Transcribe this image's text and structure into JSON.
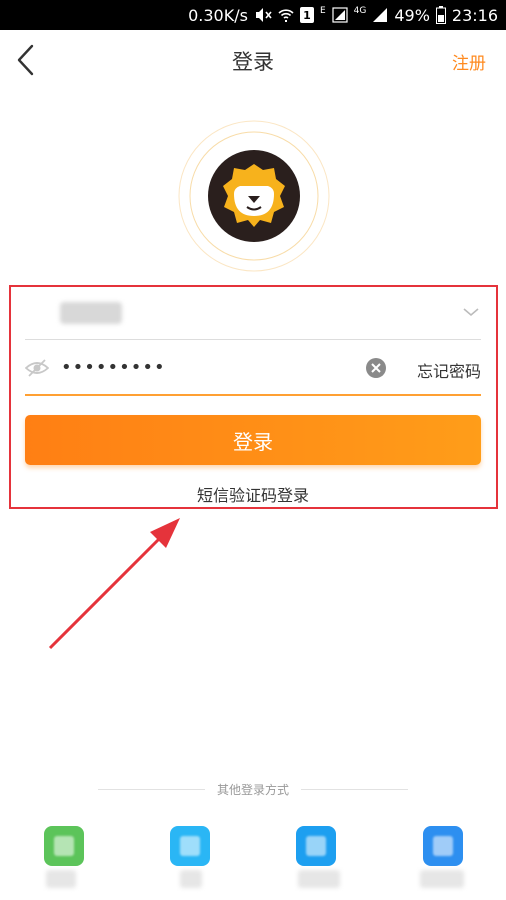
{
  "status_bar": {
    "speed": "0.30K/s",
    "sim": "1",
    "network_e": "E",
    "network_4g": "4G",
    "battery": "49%",
    "time": "23:16"
  },
  "header": {
    "title": "登录",
    "register_label": "注册"
  },
  "form": {
    "account_value": "",
    "password_value": "•••••••••",
    "forgot_label": "忘记密码",
    "login_label": "登录",
    "sms_login_label": "短信验证码登录"
  },
  "other_login": {
    "title": "其他登录方式",
    "methods": [
      {
        "icon": "wechat-icon",
        "color": "#5cc45a",
        "label": ""
      },
      {
        "icon": "qq-icon",
        "color": "#2ab6f5",
        "label": ""
      },
      {
        "icon": "alipay-icon",
        "color": "#1d9ff0",
        "label": ""
      },
      {
        "icon": "app-icon",
        "color": "#2d8ff0",
        "label": ""
      }
    ]
  },
  "colors": {
    "accent": "#ff8a1f",
    "highlight": "#e5333b"
  }
}
